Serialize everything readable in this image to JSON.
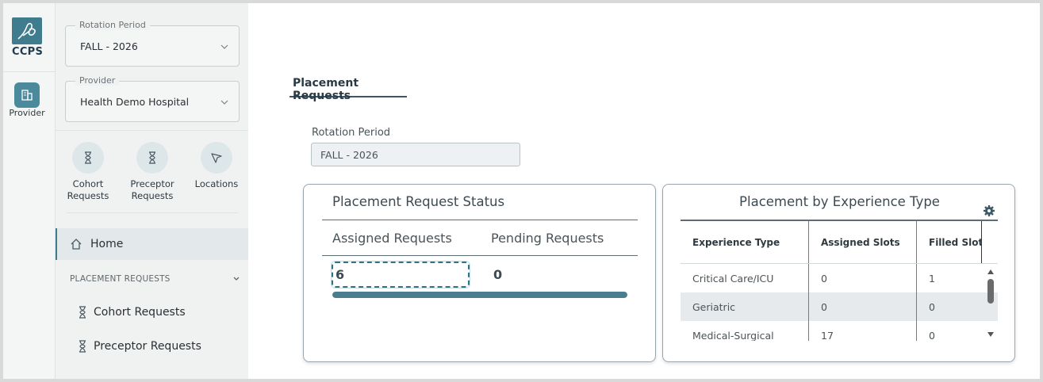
{
  "brand": {
    "logo_text": "CCPS",
    "accent_color": "#3f7c8e"
  },
  "rail": {
    "provider_label": "Provider",
    "provider_icon": "building-icon"
  },
  "sidebar": {
    "rotation_field": {
      "label": "Rotation Period",
      "value": "FALL - 2026"
    },
    "provider_field": {
      "label": "Provider",
      "value": "Health Demo Hospital"
    },
    "quick_links": [
      {
        "label_line1": "Cohort",
        "label_line2": "Requests",
        "icon": "hourglass-icon"
      },
      {
        "label_line1": "Preceptor",
        "label_line2": "Requests",
        "icon": "hourglass-icon"
      },
      {
        "label_line1": "Locations",
        "label_line2": "",
        "icon": "cursor-arrow-icon"
      }
    ],
    "home_label": "Home",
    "section_label": "PLACEMENT REQUESTS",
    "items": [
      {
        "label": "Cohort Requests",
        "icon": "hourglass-icon"
      },
      {
        "label": "Preceptor Requests",
        "icon": "hourglass-icon"
      }
    ]
  },
  "main": {
    "tab_label": "Placement Requests",
    "rotation_label": "Rotation Period",
    "rotation_value": "FALL - 2026",
    "status_card": {
      "title": "Placement Request Status",
      "col1": "Assigned Requests",
      "col2": "Pending Requests",
      "assigned": "6",
      "pending": "0",
      "progress_percent": 100
    },
    "experience_card": {
      "title": "Placement by Experience Type",
      "headers": [
        "Experience Type",
        "Assigned Slots",
        "Filled Slots"
      ],
      "rows": [
        [
          "Critical Care/ICU",
          "0",
          "1"
        ],
        [
          "Geriatric",
          "0",
          "0"
        ],
        [
          "Medical-Surgical",
          "17",
          "0"
        ]
      ]
    }
  }
}
